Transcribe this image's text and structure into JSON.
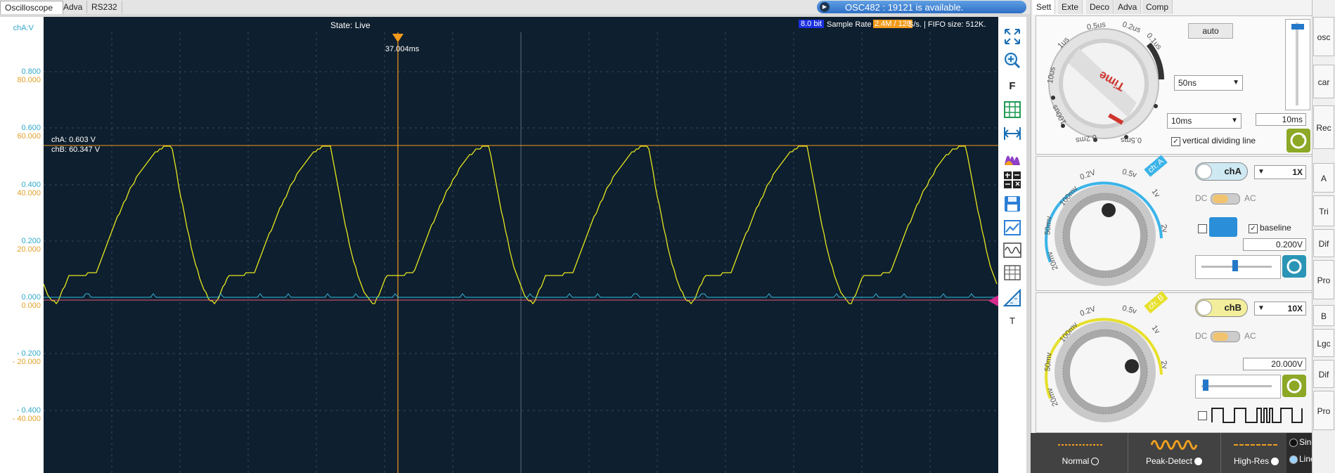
{
  "top_tabs": [
    "Oscilloscope",
    "Adva",
    "RS232"
  ],
  "notice": "OSC482 : 19121 is available.",
  "status": {
    "state": "State: Live",
    "bit": "8.0 bit",
    "sample_label": "Sample Rate",
    "sample_value": "2.4M / 120",
    "fifo": "S/s. | FIFO size: 512K."
  },
  "trigger_time": "37.004ms",
  "cursor_readout": {
    "cha": "chA: 0.603 V",
    "chb": "chB: 60.347 V"
  },
  "axis_unit": "chA:V",
  "axis_labels": [
    {
      "a": "0.800",
      "b": "80.000"
    },
    {
      "a": "0.600",
      "b": "60.000"
    },
    {
      "a": "0.400",
      "b": "40.000"
    },
    {
      "a": "0.200",
      "b": "20.000"
    },
    {
      "a": "0.000",
      "b": "0.000"
    },
    {
      "a": "- 0.200",
      "b": "- 20.000"
    },
    {
      "a": "- 0.400",
      "b": "- 40.000"
    }
  ],
  "colors": {
    "cha": "#2fa9c8",
    "chb": "#e2a12a",
    "trace_b": "#e6e61e",
    "trace_a": "#33bde0",
    "screen": "#0e1f2f"
  },
  "toolbar_icons": [
    "fit-icon",
    "zoom-icon",
    "font-icon",
    "grid-icon",
    "measure-icon",
    "histogram-icon",
    "calc-icon",
    "save-icon",
    "export-icon",
    "wave-icon",
    "table-icon",
    "ruler-icon",
    "text-icon"
  ],
  "toolbar_letters": {
    "font": "F",
    "text": "T"
  },
  "right_tabs": [
    "Sett",
    "Exte",
    "Deco",
    "Adva",
    "Comp"
  ],
  "time": {
    "dial_labels": [
      "10us",
      "1us",
      "0.5us",
      "0.2us",
      "0.1us",
      "100us",
      "0.2ms",
      "0.5ms",
      "Time"
    ],
    "auto_label": "auto",
    "combo1": "50ns",
    "combo2": "10ms",
    "field": "10ms",
    "vertical_label": "vertical dividing line"
  },
  "cha_panel": {
    "tag": "ch: A",
    "dial_labels": [
      "100mv",
      "0.2V",
      "0.5v",
      "1v",
      "2v",
      "50mv",
      "20mv"
    ],
    "toggle": "chA",
    "probe": "1X",
    "dc": "DC",
    "ac": "AC",
    "baseline": "baseline",
    "value": "0.200V"
  },
  "chb_panel": {
    "tag": "ch: B",
    "dial_labels": [
      "100mv",
      "0.2V",
      "0.5v",
      "1v",
      "2v",
      "50mv",
      "20mv"
    ],
    "toggle": "chB",
    "probe": "10X",
    "dc": "DC",
    "ac": "AC",
    "value": "20.000V"
  },
  "side_tabs": [
    "osc",
    "car",
    "Rec",
    "A",
    "Tri",
    "Dif",
    "Pro",
    "B",
    "Lgc",
    "Dif",
    "Pro"
  ],
  "modes": [
    "Normal",
    "Peak-Detect",
    "High-Res"
  ],
  "interp": [
    "Sine",
    "Linear"
  ]
}
